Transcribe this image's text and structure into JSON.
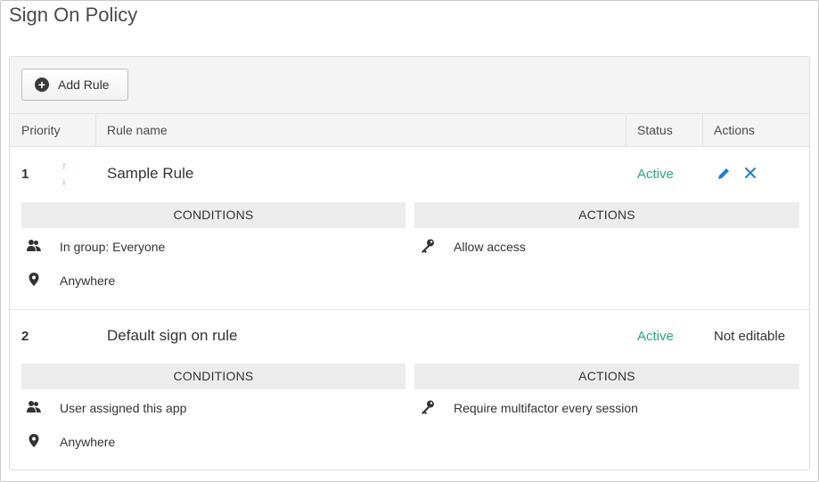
{
  "page": {
    "title": "Sign On Policy"
  },
  "toolbar": {
    "add_rule_label": "Add Rule",
    "add_icon": "plus-circle-icon"
  },
  "table": {
    "headers": {
      "priority": "Priority",
      "rule_name": "Rule name",
      "status": "Status",
      "actions": "Actions"
    }
  },
  "rules": [
    {
      "priority": "1",
      "name": "Sample Rule",
      "status": "Active",
      "conditions_header": "CONDITIONS",
      "actions_header": "ACTIONS",
      "conditions": [
        "In group: Everyone",
        "Anywhere"
      ],
      "actions": [
        "Allow access"
      ],
      "edit_icon": "pencil-icon",
      "delete_icon": "close-icon"
    },
    {
      "priority": "2",
      "name": "Default sign on rule",
      "status": "Active",
      "actions_text": "Not editable",
      "conditions_header": "CONDITIONS",
      "actions_header": "ACTIONS",
      "conditions": [
        "User assigned this app",
        "Anywhere"
      ],
      "actions": [
        "Require multifactor every session"
      ]
    }
  ],
  "colors": {
    "active": "#2aa878",
    "accent": "#1a7fd0",
    "sort_arrows": "#6fb3e8"
  }
}
